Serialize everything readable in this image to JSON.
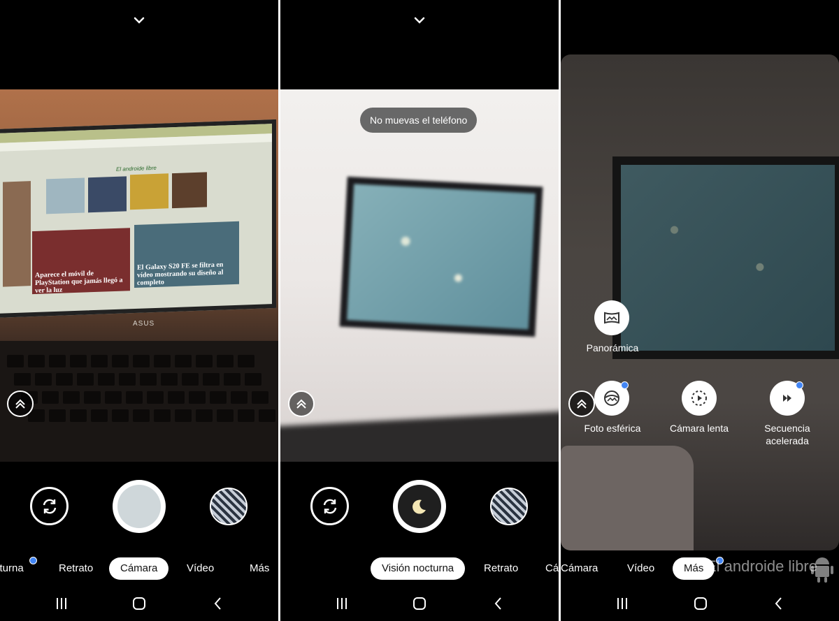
{
  "panels": [
    {
      "modes": [
        "cturna",
        "Retrato",
        "Cámara",
        "Vídeo",
        "Más"
      ],
      "active_mode": "Cámara",
      "shutter_style": "photo",
      "viewfinder": {
        "laptop_brand": "ASUS",
        "site_logo": "El androide libre",
        "headlines": [
          "Aparece el móvil de PlayStation que jamás llegó a ver la luz",
          "El Galaxy S20 FE se filtra en vídeo mostrando su diseño al completo"
        ]
      }
    },
    {
      "toast": "No muevas el teléfono",
      "modes": [
        "Visión nocturna",
        "Retrato",
        "Cá"
      ],
      "active_mode": "Visión nocturna",
      "shutter_style": "night"
    },
    {
      "modes": [
        "Cámara",
        "Vídeo",
        "Más"
      ],
      "active_mode": "Más",
      "more_modes": [
        {
          "label": "Panorámica",
          "icon": "panorama-icon",
          "badge": false
        },
        {
          "label": "Foto esférica",
          "icon": "photo-sphere-icon",
          "badge": true
        },
        {
          "label": "Cámara lenta",
          "icon": "slow-motion-icon",
          "badge": false
        },
        {
          "label": "Secuencia acelerada",
          "icon": "time-lapse-icon",
          "badge": true
        }
      ]
    }
  ],
  "watermark": "El androide libre",
  "colors": {
    "badge": "#4285f4",
    "active_pill": "#ffffff",
    "background": "#000000"
  }
}
